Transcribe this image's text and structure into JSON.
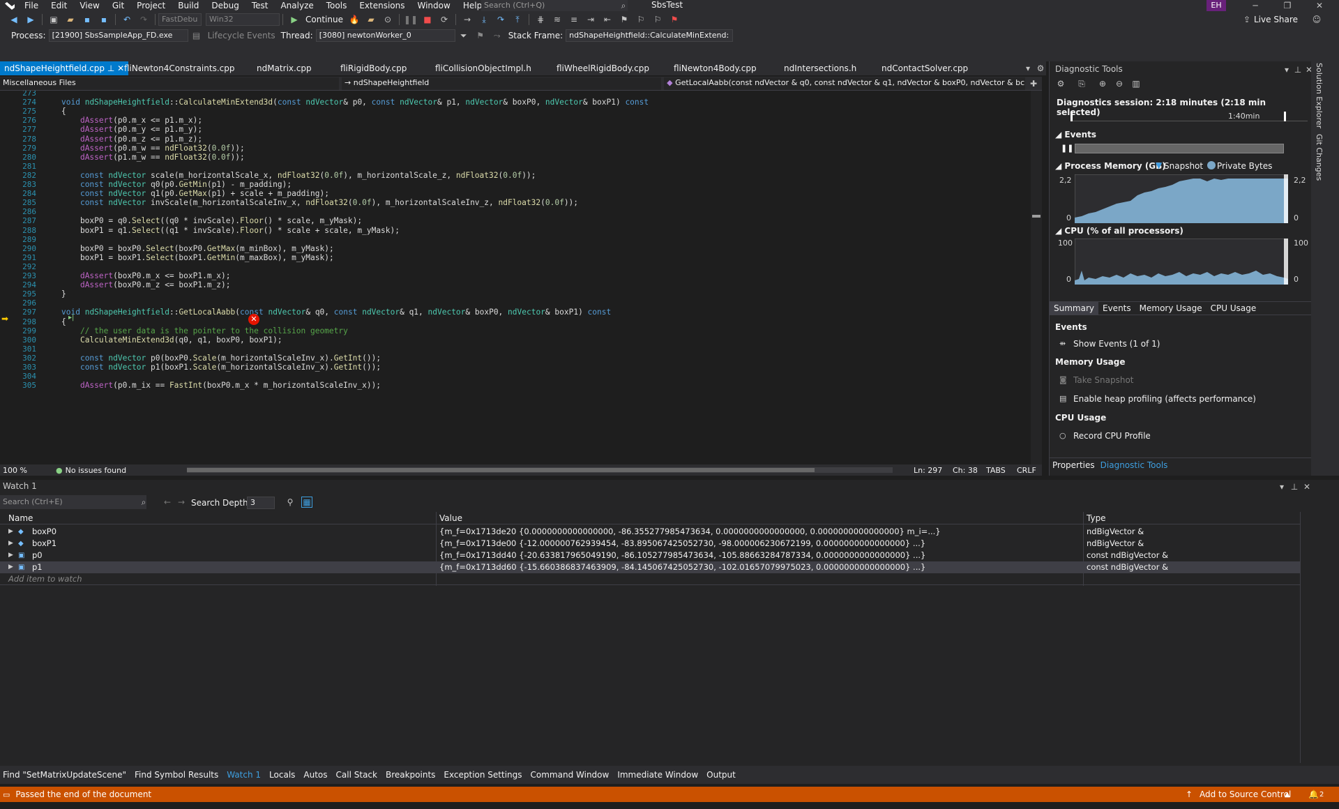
{
  "menubar": {
    "items": [
      "File",
      "Edit",
      "View",
      "Git",
      "Project",
      "Build",
      "Debug",
      "Test",
      "Analyze",
      "Tools",
      "Extensions",
      "Window",
      "Help"
    ],
    "search_placeholder": "Search (Ctrl+Q)",
    "solution_name": "SbsTest",
    "user_initials": "EH"
  },
  "toolbar": {
    "config": "FastDebu",
    "platform": "Win32",
    "continue_label": "Continue",
    "live_share": "Live Share"
  },
  "debugbar": {
    "process_label": "Process:",
    "process_value": "[21900] SbsSampleApp_FD.exe",
    "lifecycle": "Lifecycle Events",
    "thread_label": "Thread:",
    "thread_value": "[3080] newtonWorker_0",
    "stackframe_label": "Stack Frame:",
    "stackframe_value": "ndShapeHeightfield::CalculateMinExtend:"
  },
  "tabs": [
    {
      "label": "ndShapeHeightfield.cpp",
      "active": true
    },
    {
      "label": "fliNewton4Constraints.cpp"
    },
    {
      "label": "ndMatrix.cpp"
    },
    {
      "label": "fliRigidBody.cpp"
    },
    {
      "label": "fliCollisionObjectImpl.h"
    },
    {
      "label": "fliWheelRigidBody.cpp"
    },
    {
      "label": "fliNewton4Body.cpp"
    },
    {
      "label": "ndIntersections.h"
    },
    {
      "label": "ndContactSolver.cpp"
    }
  ],
  "navbar": {
    "project": "Miscellaneous Files",
    "scope": "ndShapeHeightfield",
    "member": "GetLocalAabb(const ndVector & q0, const ndVector & q1, ndVector & boxP0, ndVector & bc"
  },
  "code_lines": [
    {
      "n": "273",
      "text": ""
    },
    {
      "n": "274",
      "text": "void ndShapeHeightfield::CalculateMinExtend3d(const ndVector& p0, const ndVector& p1, ndVector& boxP0, ndVector& boxP1) const"
    },
    {
      "n": "275",
      "text": "{"
    },
    {
      "n": "276",
      "text": "    dAssert(p0.m_x <= p1.m_x);"
    },
    {
      "n": "277",
      "text": "    dAssert(p0.m_y <= p1.m_y);"
    },
    {
      "n": "278",
      "text": "    dAssert(p0.m_z <= p1.m_z);"
    },
    {
      "n": "279",
      "text": "    dAssert(p0.m_w == ndFloat32(0.0f));"
    },
    {
      "n": "280",
      "text": "    dAssert(p1.m_w == ndFloat32(0.0f));"
    },
    {
      "n": "281",
      "text": ""
    },
    {
      "n": "282",
      "text": "    const ndVector scale(m_horizontalScale_x, ndFloat32(0.0f), m_horizontalScale_z, ndFloat32(0.0f));"
    },
    {
      "n": "283",
      "text": "    const ndVector q0(p0.GetMin(p1) - m_padding);"
    },
    {
      "n": "284",
      "text": "    const ndVector q1(p0.GetMax(p1) + scale + m_padding);"
    },
    {
      "n": "285",
      "text": "    const ndVector invScale(m_horizontalScaleInv_x, ndFloat32(0.0f), m_horizontalScaleInv_z, ndFloat32(0.0f));"
    },
    {
      "n": "286",
      "text": ""
    },
    {
      "n": "287",
      "text": "    boxP0 = q0.Select((q0 * invScale).Floor() * scale, m_yMask);"
    },
    {
      "n": "288",
      "text": "    boxP1 = q1.Select((q1 * invScale).Floor() * scale + scale, m_yMask);"
    },
    {
      "n": "289",
      "text": ""
    },
    {
      "n": "290",
      "text": "    boxP0 = boxP0.Select(boxP0.GetMax(m_minBox), m_yMask);"
    },
    {
      "n": "291",
      "text": "    boxP1 = boxP1.Select(boxP1.GetMin(m_maxBox), m_yMask);"
    },
    {
      "n": "292",
      "text": ""
    },
    {
      "n": "293",
      "text": "    dAssert(boxP0.m_x <= boxP1.m_x);"
    },
    {
      "n": "294",
      "text": "    dAssert(boxP0.m_z <= boxP1.m_z);"
    },
    {
      "n": "295",
      "text": "}"
    },
    {
      "n": "296",
      "text": ""
    },
    {
      "n": "297",
      "text": "void ndShapeHeightfield::GetLocalAabb(const ndVector& q0, const ndVector& q1, ndVector& boxP0, ndVector& boxP1) const"
    },
    {
      "n": "298",
      "text": "{"
    },
    {
      "n": "299",
      "text": "    // the user data is the pointer to the collision geometry"
    },
    {
      "n": "300",
      "text": "    CalculateMinExtend3d(q0, q1, boxP0, boxP1);"
    },
    {
      "n": "301",
      "text": ""
    },
    {
      "n": "302",
      "text": "    const ndVector p0(boxP0.Scale(m_horizontalScaleInv_x).GetInt());"
    },
    {
      "n": "303",
      "text": "    const ndVector p1(boxP1.Scale(m_horizontalScaleInv_x).GetInt());"
    },
    {
      "n": "304",
      "text": ""
    },
    {
      "n": "305",
      "text": "    dAssert(p0.m_ix == FastInt(boxP0.m_x * m_horizontalScaleInv_x));"
    }
  ],
  "editor_status": {
    "zoom": "100 %",
    "issues": "No issues found",
    "line": "Ln: 297",
    "col": "Ch: 38",
    "tabs": "TABS",
    "eol": "CRLF"
  },
  "diagnostics": {
    "title": "Diagnostic Tools",
    "session": "Diagnostics session: 2:18 minutes (2:18 min selected)",
    "time_marker": "1:40min",
    "events_label": "Events",
    "memory_label": "Process Memory (GB)",
    "snapshot_legend": "Snapshot",
    "private_bytes_legend": "Private Bytes",
    "memory_max": "2,2",
    "memory_min": "0",
    "cpu_label": "CPU (% of all processors)",
    "cpu_max": "100",
    "cpu_min": "0",
    "tabs": [
      "Summary",
      "Events",
      "Memory Usage",
      "CPU Usage"
    ],
    "summary_events_header": "Events",
    "show_events": "Show Events (1 of 1)",
    "memory_usage_header": "Memory Usage",
    "take_snapshot": "Take Snapshot",
    "heap_profiling": "Enable heap profiling (affects performance)",
    "cpu_usage_header": "CPU Usage",
    "record_cpu": "Record CPU Profile",
    "bottom_tabs": [
      "Properties",
      "Diagnostic Tools"
    ]
  },
  "sidestrip": {
    "items": [
      "Solution Explorer",
      "Git Changes"
    ]
  },
  "watch": {
    "title": "Watch 1",
    "search_placeholder": "Search (Ctrl+E)",
    "search_depth_label": "Search Depth:",
    "search_depth_value": "3",
    "columns": [
      "Name",
      "Value",
      "Type"
    ],
    "rows": [
      {
        "name": "boxP0",
        "value": "{m_f=0x1713de20 {0.0000000000000000, -86.355277985473634, 0.0000000000000000, 0.0000000000000000} m_i=...}",
        "type": "ndBigVector &"
      },
      {
        "name": "boxP1",
        "value": "{m_f=0x1713de00 {-12.000000762939454, -83.895067425052730, -98.000006230672199, 0.0000000000000000} ...}",
        "type": "ndBigVector &"
      },
      {
        "name": "p0",
        "value": "{m_f=0x1713dd40 {-20.633817965049190, -86.105277985473634, -105.88663284787334, 0.0000000000000000} ...}",
        "type": "const ndBigVector &"
      },
      {
        "name": "p1",
        "value": "{m_f=0x1713dd60 {-15.660386837463909, -84.145067425052730, -102.01657079975023, 0.0000000000000000} ...}",
        "type": "const ndBigVector &"
      }
    ],
    "add_item": "Add item to watch"
  },
  "bottom_tabs": [
    "Find \"SetMatrixUpdateScene\"",
    "Find Symbol Results",
    "Watch 1",
    "Locals",
    "Autos",
    "Call Stack",
    "Breakpoints",
    "Exception Settings",
    "Command Window",
    "Immediate Window",
    "Output"
  ],
  "status": {
    "message": "Passed the end of the document",
    "source_control": "Add to Source Control",
    "notifications": "2"
  },
  "colors": {
    "accent": "#007acc",
    "status_bar": "#ca5100",
    "error": "#e51400"
  }
}
